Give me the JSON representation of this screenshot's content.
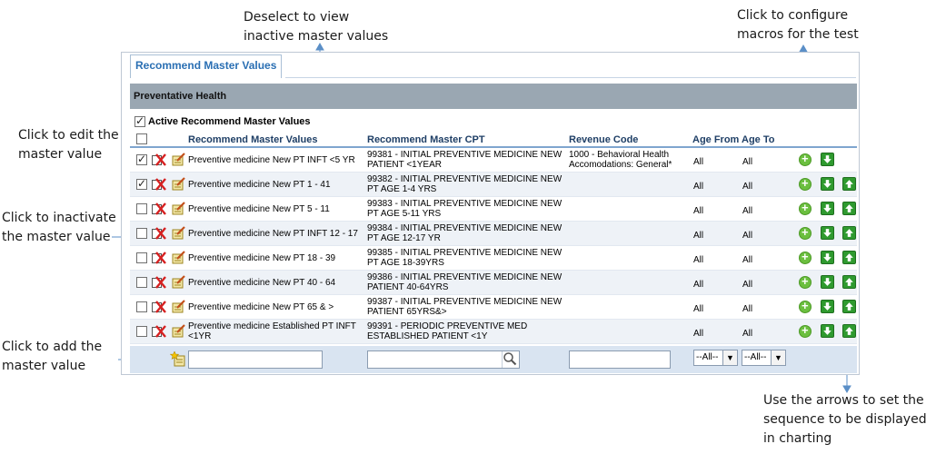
{
  "callouts": {
    "deselect": [
      "Deselect to view",
      "inactive master values"
    ],
    "configure": [
      "Click to configure",
      "macros for the test"
    ],
    "edit": [
      "Click to edit the",
      "master value"
    ],
    "inactivate": [
      "Click to inactivate",
      "the master value"
    ],
    "add": [
      "Click to add the",
      "master value"
    ],
    "arrows": [
      "Use the arrows to set the",
      "sequence to be displayed",
      "in charting"
    ]
  },
  "panel": {
    "tab_title": "Recommend Master Values",
    "section_title": "Preventative Health",
    "active_label": "Active Recommend Master Values",
    "active_checked": true
  },
  "columns": {
    "values": "Recommend Master Values",
    "cpt": "Recommend Master CPT",
    "revenue": "Revenue Code",
    "age_from": "Age From",
    "age_to": "Age To"
  },
  "rows": [
    {
      "checked": true,
      "value": [
        "Preventive medicine New PT INFT <5 YR"
      ],
      "cpt": [
        "99381 - INITIAL PREVENTIVE MEDICINE NEW",
        "PATIENT <1YEAR"
      ],
      "revenue": [
        "1000 - Behavioral Health",
        "Accomodations: General*"
      ],
      "age_from": "All",
      "age_to": "All",
      "has_up": false
    },
    {
      "checked": true,
      "value": [
        "Preventive medicine New PT 1 - 41"
      ],
      "cpt": [
        "99382 - INITIAL PREVENTIVE MEDICINE NEW",
        "PT AGE 1-4 YRS"
      ],
      "revenue": [
        "",
        ""
      ],
      "age_from": "All",
      "age_to": "All",
      "has_up": true
    },
    {
      "checked": false,
      "value": [
        "Preventive medicine New PT 5 - 11"
      ],
      "cpt": [
        "99383 - INITIAL PREVENTIVE MEDICINE NEW",
        "PT AGE 5-11 YRS"
      ],
      "revenue": [
        "",
        ""
      ],
      "age_from": "All",
      "age_to": "All",
      "has_up": true
    },
    {
      "checked": false,
      "value": [
        "Preventive medicine New PT INFT 12 - 17"
      ],
      "cpt": [
        "99384 - INITIAL PREVENTIVE MEDICINE NEW",
        "PT AGE 12-17 YR"
      ],
      "revenue": [
        "",
        ""
      ],
      "age_from": "All",
      "age_to": "All",
      "has_up": true
    },
    {
      "checked": false,
      "value": [
        "Preventive medicine New PT 18 - 39"
      ],
      "cpt": [
        "99385 - INITIAL PREVENTIVE MEDICINE NEW",
        "PT AGE 18-39YRS"
      ],
      "revenue": [
        "",
        ""
      ],
      "age_from": "All",
      "age_to": "All",
      "has_up": true
    },
    {
      "checked": false,
      "value": [
        "Preventive medicine New PT 40 - 64"
      ],
      "cpt": [
        "99386 - INITIAL PREVENTIVE MEDICINE NEW",
        "PATIENT 40-64YRS"
      ],
      "revenue": [
        "",
        ""
      ],
      "age_from": "All",
      "age_to": "All",
      "has_up": true
    },
    {
      "checked": false,
      "value": [
        "Preventive medicine New PT 65 & >"
      ],
      "cpt": [
        "99387 - INITIAL PREVENTIVE MEDICINE NEW",
        "PATIENT 65YRS&>"
      ],
      "revenue": [
        "",
        ""
      ],
      "age_from": "All",
      "age_to": "All",
      "has_up": true
    },
    {
      "checked": false,
      "value": [
        "Preventive medicine Established PT INFT",
        "<1YR"
      ],
      "cpt": [
        "99391 - PERIODIC PREVENTIVE MED",
        "ESTABLISHED PATIENT <1Y"
      ],
      "revenue": [
        "",
        ""
      ],
      "age_from": "All",
      "age_to": "All",
      "has_up": true
    }
  ],
  "add_row": {
    "value_input": "",
    "cpt_input": "",
    "revenue_input": "",
    "age_from_selected": "--All--",
    "age_to_selected": "--All--"
  },
  "icons": {
    "delete": "red-x-delete-icon",
    "edit": "pencil-notepad-edit-icon",
    "add": "star-notepad-add-icon",
    "macro": "green-plus-circle-icon",
    "down": "green-down-arrow-icon",
    "up": "green-up-arrow-icon",
    "search": "magnifier-icon"
  },
  "colors": {
    "accent": "#2a6fb3",
    "section_bar": "#9aa7b2",
    "arrow_green": "#2f9a2f",
    "delete_red": "#d62020"
  }
}
